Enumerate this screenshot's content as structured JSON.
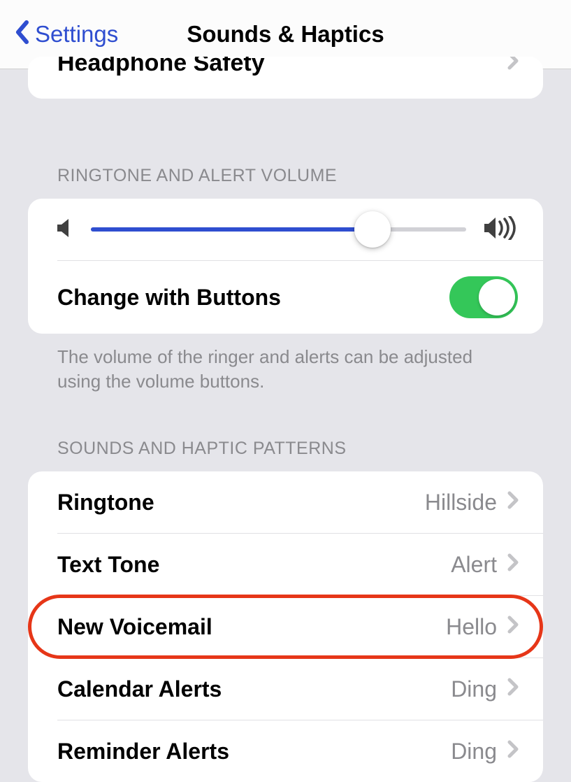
{
  "nav": {
    "back_label": "Settings",
    "title": "Sounds & Haptics"
  },
  "headphone": {
    "label": "Headphone Safety"
  },
  "volume_section": {
    "header": "RINGTONE AND ALERT VOLUME",
    "slider_percent": 75,
    "change_label": "Change with Buttons",
    "change_on": true,
    "footer": "The volume of the ringer and alerts can be adjusted using the volume buttons."
  },
  "patterns_section": {
    "header": "SOUNDS AND HAPTIC PATTERNS",
    "items": [
      {
        "label": "Ringtone",
        "value": "Hillside"
      },
      {
        "label": "Text Tone",
        "value": "Alert"
      },
      {
        "label": "New Voicemail",
        "value": "Hello",
        "highlighted": true
      },
      {
        "label": "Calendar Alerts",
        "value": "Ding"
      },
      {
        "label": "Reminder Alerts",
        "value": "Ding"
      }
    ]
  }
}
